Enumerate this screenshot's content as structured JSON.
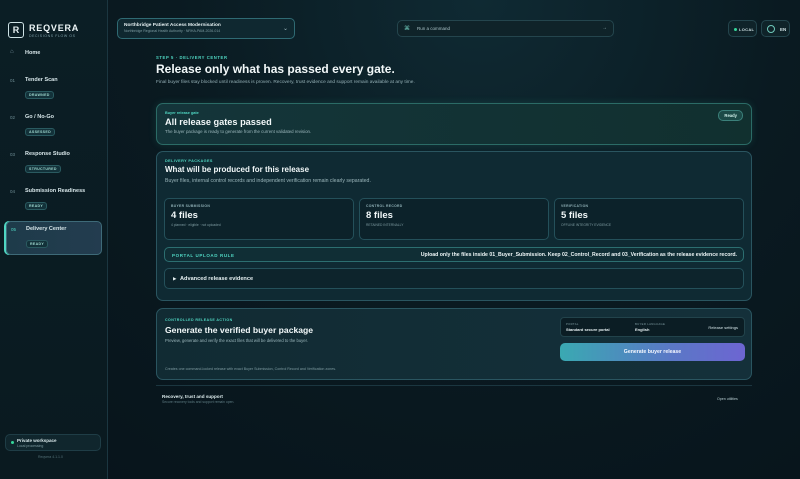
{
  "brand": {
    "name": "REQVERA",
    "tagline": "DECISIONS FLOW OS",
    "logo_letter": "R"
  },
  "sidebar": {
    "home": {
      "icon": "home-icon",
      "label": "Home"
    },
    "items": [
      {
        "num": "01",
        "label": "Tender Scan",
        "badge": "DRAWNED"
      },
      {
        "num": "02",
        "label": "Go / No-Go",
        "badge": "ASSESSED"
      },
      {
        "num": "03",
        "label": "Response Studio",
        "badge": "STRUCTURED"
      },
      {
        "num": "04",
        "label": "Submission Readiness",
        "badge": "READY"
      },
      {
        "num": "05",
        "label": "Delivery Center",
        "badge": "READY",
        "active": true
      }
    ],
    "workspace": {
      "title": "Private workspace",
      "subtitle": "Local processing"
    },
    "version": "Reqvera 4.1.1.0"
  },
  "topbar": {
    "project_title": "Northbridge Patient Access Modernisation",
    "project_sub": "Northbridge Regional Health Authority · NRHA-PAM-2026-014",
    "command_placeholder": "Run a command",
    "local_label": "LOCAL",
    "lang_label": "EN"
  },
  "header": {
    "step": "STEP 5 · DELIVERY CENTER",
    "title": "Release only what has passed every gate.",
    "subtitle": "Final buyer files stay blocked until readiness is proven. Recovery, trust evidence and support remain available at any time."
  },
  "gate": {
    "eyebrow": "Buyer release gate",
    "title": "All release gates passed",
    "desc": "The buyer package is ready to generate from the current validated revision.",
    "status": "Ready"
  },
  "packages": {
    "eyebrow": "DELIVERY PACKAGES",
    "title": "What will be produced for this release",
    "desc": "Buyer files, internal control records and independent verification remain clearly separated.",
    "stats": [
      {
        "label": "BUYER SUBMISSION",
        "value": "4 files",
        "note": "4 planned · eligible · not uploaded"
      },
      {
        "label": "CONTROL RECORD",
        "value": "8 files",
        "note": "RETAINED INTERNALLY"
      },
      {
        "label": "VERIFICATION",
        "value": "5 files",
        "note": "OFFLINE INTEGRITY EVIDENCE"
      }
    ],
    "rule_label": "PORTAL UPLOAD RULE",
    "rule_text": "Upload only the files inside 01_Buyer_Submission. Keep 02_Control_Record and 03_Verification as the release evidence record.",
    "advanced_label": "Advanced release evidence"
  },
  "action": {
    "eyebrow": "CONTROLLED RELEASE ACTION",
    "title": "Generate the verified buyer package",
    "desc": "Preview, generate and verify the exact files that will be delivered to the buyer.",
    "foot": "Creates one command-locked release with exact Buyer Submission, Control Record and Verification zones.",
    "portal_key": "PORTAL",
    "portal_val": "Standard secure portal",
    "lang_key": "BUYER LANGUAGE",
    "lang_val": "English",
    "settings_link": "Release settings",
    "button": "Generate buyer release"
  },
  "footer": {
    "title": "Recovery, trust and support",
    "subtitle": "Secure recovery tools and support remain open.",
    "open_label": "Open utilities"
  }
}
